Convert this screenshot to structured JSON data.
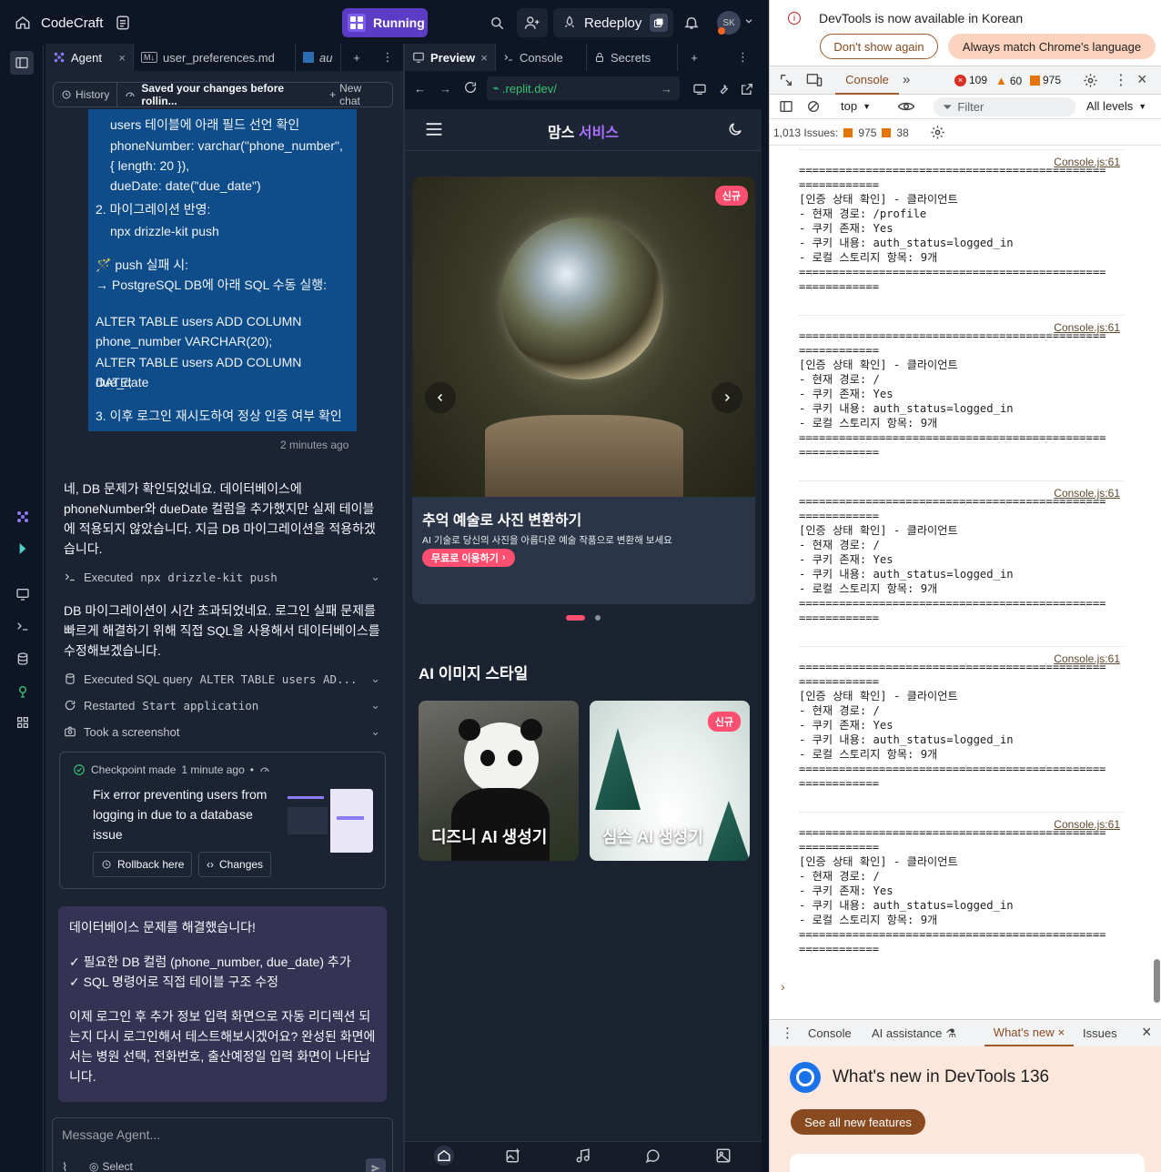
{
  "topbar": {
    "app_name": "CodeCraft",
    "run_label": "Running",
    "redeploy_label": "Redeploy",
    "avatar_initials": "SK"
  },
  "agent_tabs": [
    {
      "label": "Agent"
    },
    {
      "label": "user_preferences.md"
    },
    {
      "label": "au"
    }
  ],
  "agent_toolbar": {
    "history": "History",
    "status": "Saved your changes before rollin...",
    "new_chat": "New chat"
  },
  "user_bubble": {
    "lines": [
      "users 테이블에 아래 필드 선언 확인",
      "phoneNumber: varchar(\"phone_number\",",
      "{ length: 20 }),",
      "dueDate: date(\"due_date\")",
      "2. 마이그레이션 반영:",
      "npx drizzle-kit push",
      "🪄 push 실패 시:",
      "→ PostgreSQL DB에 아래 SQL 수동 실행:",
      "ALTER TABLE users ADD COLUMN",
      "phone_number VARCHAR(20);",
      "ALTER TABLE users ADD COLUMN due_date",
      "DATE;",
      "3. 이후 로그인 재시도하여 정상 인증 여부 확인"
    ],
    "timestamp": "2 minutes ago"
  },
  "agent_msg1": "네, DB 문제가 확인되었네요. 데이터베이스에 phoneNumber와 dueDate 컬럼을 추가했지만 실제 테이블에 적용되지 않았습니다. 지금 DB 마이그레이션을 적용하겠습니다.",
  "action_exec": {
    "prefix": "Executed",
    "cmd": "npx drizzle-kit push"
  },
  "agent_msg2": "DB 마이그레이션이 시간 초과되었네요. 로그인 실패 문제를 빠르게 해결하기 위해 직접 SQL을 사용해서 데이터베이스를 수정해보겠습니다.",
  "action_sql": {
    "prefix": "Executed SQL query",
    "cmd": "ALTER TABLE users AD..."
  },
  "action_restart": {
    "prefix": "Restarted",
    "cmd": "Start application"
  },
  "action_screenshot": {
    "label": "Took a screenshot"
  },
  "checkpoint": {
    "header": "Checkpoint made",
    "time": "1 minute ago",
    "desc": "Fix error preventing users from logging in due to a database issue",
    "rollback": "Rollback here",
    "changes": "Changes"
  },
  "agent_final": {
    "l1": "데이터베이스 문제를 해결했습니다!",
    "l2": "✓ 필요한 DB 컬럼 (phone_number, due_date) 추가",
    "l3": "✓ SQL 명령어로 직접 테이블 구조 수정",
    "l4": "이제 로그인 후 추가 정보 입력 화면으로 자동 리디렉션 되는지 다시 로그인해서 테스트해보시겠어요? 완성된 화면에서는 병원 선택, 전화번호, 출산예정일 입력 화면이 나타납니다."
  },
  "message_input": {
    "placeholder": "Message Agent...",
    "select": "Select"
  },
  "preview_tabs": [
    {
      "label": "Preview"
    },
    {
      "label": "Console"
    },
    {
      "label": "Secrets"
    }
  ],
  "url": ".replit.dev/",
  "app": {
    "brand_a": "맘스",
    "brand_b": "서비스",
    "slide_badge": "신규",
    "slide_title": "추억 예술로 사진 변환하기",
    "slide_sub": "AI 기술로 당신의 사진을 아름다운 예술 작품으로 변환해 보세요",
    "slide_cta": "무료로 이용하기",
    "section_title": "AI 이미지 스타일",
    "card1": "디즈니 AI 생성기",
    "card2": "심슨 AI 생성기",
    "card2_badge": "신규"
  },
  "devtools": {
    "info": "DevTools is now available in Korean",
    "dont_show": "Don't show again",
    "always_match": "Always match Chrome's language",
    "console_tab": "Console",
    "errors": "109",
    "warnings": "60",
    "infos": "975",
    "context": "top",
    "filter_placeholder": "Filter",
    "levels": "All levels",
    "issues_label": "1,013 Issues:",
    "issues_warn": "975",
    "issues_info": "38",
    "log_source": "Console.js:61",
    "logs": [
      {
        "path": "/profile"
      },
      {
        "path": "/"
      },
      {
        "path": "/"
      },
      {
        "path": "/"
      },
      {
        "path": "/"
      }
    ],
    "log_sep1": "==============================================",
    "log_sep2": "============",
    "log_head": "[인증 상태 확인] - 클라이언트",
    "log_path_label": "- 현재 경로:",
    "log_cookie": "- 쿠키 존재: Yes",
    "log_cookie_content": "- 쿠키 내용: auth_status=logged_in",
    "log_storage": "- 로컬 스토리지 항목: 9개",
    "prompt": "›",
    "drawer_tabs": [
      "Console",
      "AI assistance",
      "What's new",
      "Issues"
    ],
    "whats_new_title": "What's new in DevTools 136",
    "see_all": "See all new features"
  }
}
